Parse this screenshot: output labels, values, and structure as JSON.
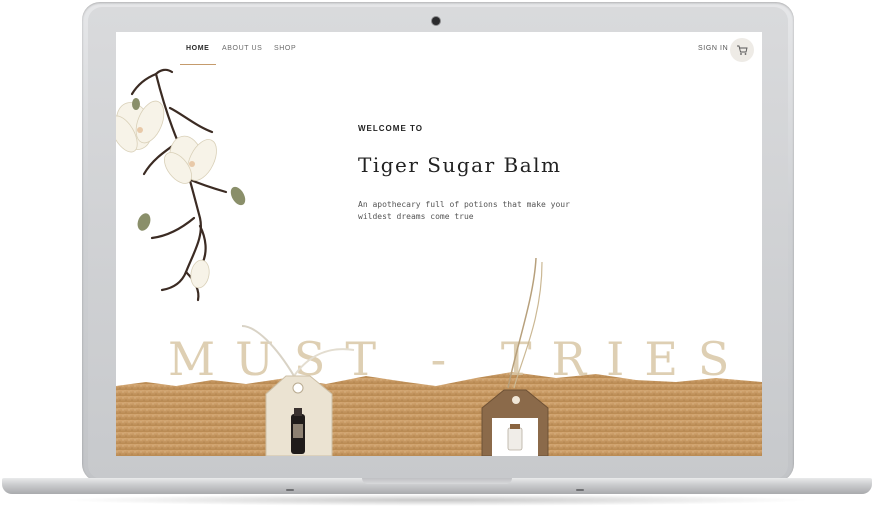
{
  "nav": {
    "links": [
      "HOME",
      "ABOUT US",
      "SHOP"
    ],
    "sign_in": "SIGN IN"
  },
  "hero": {
    "welcome": "WELCOME TO",
    "title": "Tiger Sugar Balm",
    "tagline": "An apothecary full of potions that make your wildest dreams come true"
  },
  "banner": {
    "text": "MUST - TRIES"
  },
  "colors": {
    "accent": "#c59b6c",
    "banner_texture": "#c69862",
    "banner_text": "#d9c7a6"
  },
  "icons": [
    "cart-icon",
    "magnolia-branch-image",
    "gift-tag-image"
  ]
}
